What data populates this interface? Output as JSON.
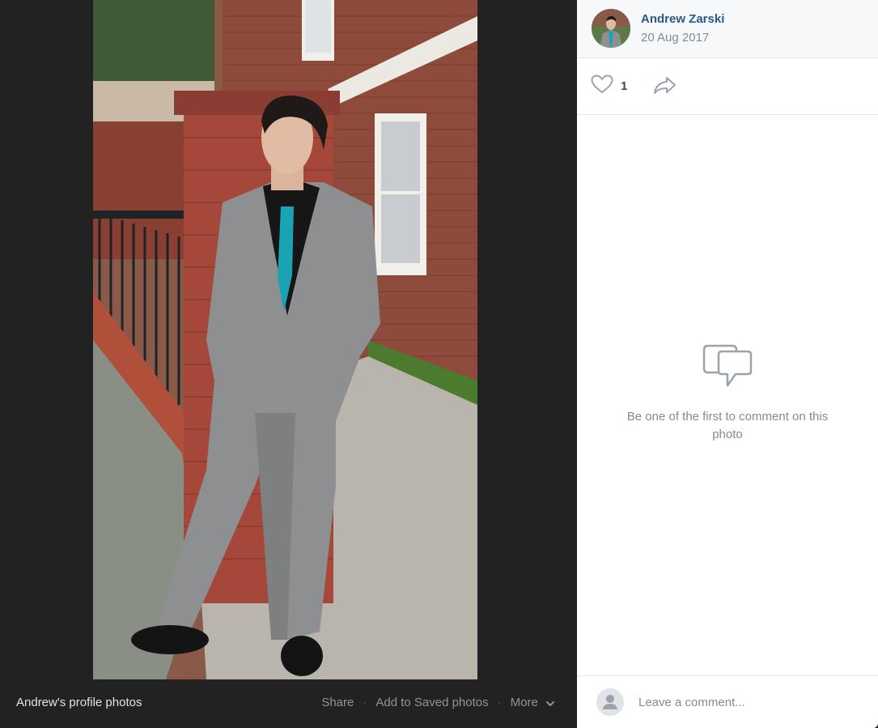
{
  "photo": {
    "description_icon": "portrait-photo"
  },
  "footer": {
    "album_label": "Andrew's profile photos",
    "actions": {
      "share": "Share",
      "save": "Add to Saved photos",
      "more": "More"
    },
    "separator": "·"
  },
  "post": {
    "author": "Andrew Zarski",
    "date": "20 Aug 2017",
    "likes": "1"
  },
  "comments": {
    "empty_text": "Be one of the first to comment on this photo",
    "placeholder": "Leave a comment..."
  },
  "colors": {
    "accent": "#2a5885",
    "muted": "#818c99",
    "dark_bg": "#222222"
  }
}
